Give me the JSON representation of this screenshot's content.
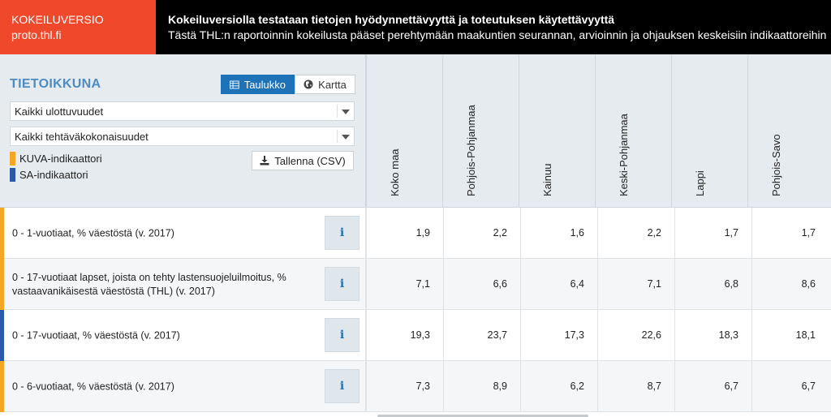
{
  "banner": {
    "version_label": "KOKEILUVERSIO",
    "site": "proto.thl.fi",
    "title": "Kokeiluversiolla testataan tietojen hyödynnettävyyttä ja toteutuksen käytettävyyttä",
    "subtitle": "Tästä THL:n raportoinnin kokeilusta pääset perehtymään maakuntien seurannan, arvioinnin ja ohjauksen keskeisiin indikaattoreihin"
  },
  "panel": {
    "title": "TIETOIKKUNA",
    "view_toggle": {
      "table_label": "Taulukko",
      "map_label": "Kartta",
      "selected": "table"
    },
    "dimension_select": "Kaikki ulottuvuudet",
    "task_select": "Kaikki tehtäväkokonaisuudet",
    "legend": [
      {
        "label": "KUVA-indikaattori",
        "color": "#f5a623"
      },
      {
        "label": "SA-indikaattori",
        "color": "#2a5aa8"
      }
    ],
    "save_label": "Tallenna (CSV)"
  },
  "columns": [
    "Koko maa",
    "Pohjois-Pohjanmaa",
    "Kainuu",
    "Keski-Pohjanmaa",
    "Lappi",
    "Pohjois-Savo"
  ],
  "rows": [
    {
      "label": "0 - 1-vuotiaat, % väestöstä (v. 2017)",
      "type": "KUVA",
      "values": [
        "1,9",
        "2,2",
        "1,6",
        "2,2",
        "1,7",
        "1,7"
      ]
    },
    {
      "label": "0 - 17-vuotiaat lapset, joista on tehty lastensuojeluilmoitus, % vastaavanikäisestä väestöstä (THL) (v. 2017)",
      "type": "KUVA",
      "values": [
        "7,1",
        "6,6",
        "6,4",
        "7,1",
        "6,8",
        "8,6"
      ]
    },
    {
      "label": "0 - 17-vuotiaat, % väestöstä (v. 2017)",
      "type": "SA",
      "values": [
        "19,3",
        "23,7",
        "17,3",
        "22,6",
        "18,3",
        "18,1"
      ]
    },
    {
      "label": "0 - 6-vuotiaat, % väestöstä (v. 2017)",
      "type": "KUVA",
      "values": [
        "7,3",
        "8,9",
        "6,2",
        "8,7",
        "6,7",
        "6,7"
      ]
    }
  ],
  "info_icon_glyph": "i",
  "colors": {
    "kuva": "#f5a623",
    "sa": "#2a5aa8",
    "accent": "#1e73b8",
    "banner_orange": "#f0482a"
  }
}
